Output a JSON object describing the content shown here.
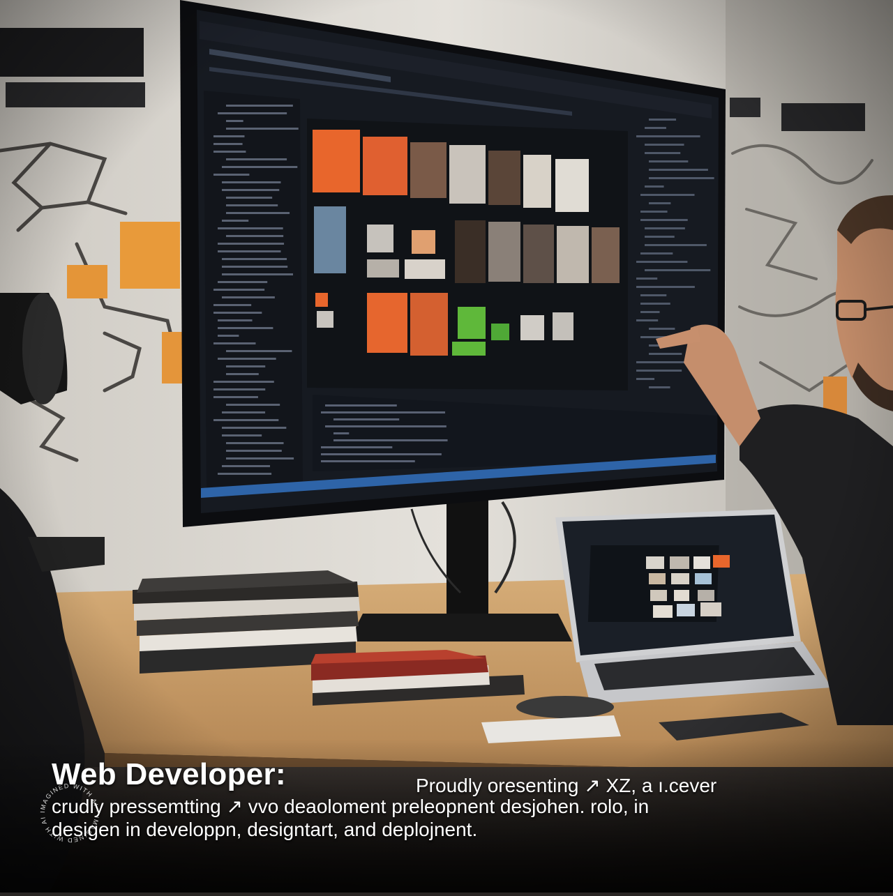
{
  "caption": {
    "title": "Web Developer:",
    "line1": "Proudly oresenting ↗ XZ, a ı.cever",
    "line2": "crudly pressemtting ↗ vvo deaoloment preleopnent desjohen. rolo, in",
    "line3": "desigen in developpn, designtart, and deplojnent."
  },
  "watermark": {
    "text": "IMAGINED WITH AI · IMAGINED WITH AI ·"
  },
  "colors": {
    "accent_orange": "#e8662c",
    "accent_green": "#5fb83a",
    "screen_bg": "#171b22",
    "desk": "#c79a62",
    "wall": "#d9d6d0"
  }
}
